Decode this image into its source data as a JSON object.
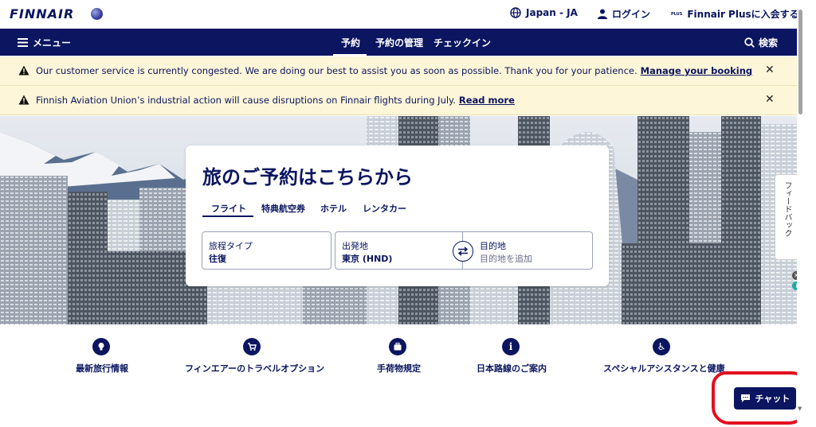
{
  "brand": {
    "logo": "FINNAIR",
    "accent": "#0b1560",
    "alert_bg": "#fdf6d8"
  },
  "topbar": {
    "language": "Japan - JA",
    "login": "ログイン",
    "plus_badge": "PLUS",
    "plus": "Finnair Plusに入会する"
  },
  "nav": {
    "menu": "メニュー",
    "tabs": [
      {
        "label": "予約",
        "active": true
      },
      {
        "label": "予約の管理",
        "active": false
      },
      {
        "label": "チェックイン",
        "active": false
      }
    ],
    "search": "検索"
  },
  "alerts": [
    {
      "message": "Our customer service is currently congested. We are doing our best to assist you as soon as possible. Thank you for your patience.",
      "link": "Manage your booking"
    },
    {
      "message": "Finnish Aviation Union’s industrial action will cause disruptions on Finnair flights during July.",
      "link": "Read more"
    }
  ],
  "booking": {
    "title": "旅のご予約はこちらから",
    "tabs": [
      "フライト",
      "特典航空券",
      "ホテル",
      "レンタカー"
    ],
    "active_tab": "フライト",
    "trip_type": {
      "label": "旅程タイプ",
      "value": "往復"
    },
    "origin": {
      "label": "出発地",
      "value": "東京 (HND)"
    },
    "destination": {
      "label": "目的地",
      "placeholder": "目的地を追加"
    }
  },
  "feedback": "フィードバック",
  "quick_links": [
    {
      "label": "最新旅行情報",
      "icon": "news-icon"
    },
    {
      "label": "フィンエアーのトラベルオプション",
      "icon": "cart-icon"
    },
    {
      "label": "手荷物規定",
      "icon": "baggage-icon"
    },
    {
      "label": "日本路線のご案内",
      "icon": "info-icon"
    },
    {
      "label": "スペシャルアシスタンスと健康",
      "icon": "wheelchair-icon"
    }
  ],
  "chat": {
    "label": "チャット",
    "annotation_color": "#e3101d"
  }
}
